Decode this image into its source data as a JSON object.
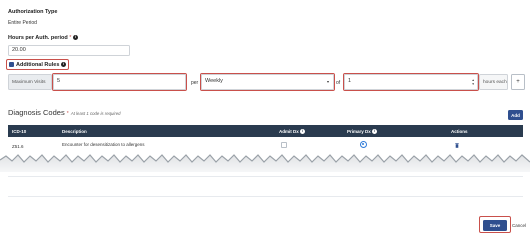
{
  "authorization": {
    "type_label": "Authorization Type",
    "type_value": "Entire Period",
    "hours_label": "Hours per Auth. period",
    "hours_required_mark": "*",
    "hours_value": "20.00"
  },
  "additional_rules": {
    "label": "Additional Rules",
    "checked": true,
    "max_visits_label": "Maximum Visits",
    "max_visits_value": "5",
    "per_label": "per",
    "frequency_selected": "Weekly",
    "of_label": "of",
    "hours_each_value": "1",
    "hours_each_label": "hours each",
    "add_button_label": "+"
  },
  "diagnosis": {
    "title": "Diagnosis Codes",
    "required_mark": "*",
    "hint": "At least 1 code is required",
    "add_button": "Add",
    "columns": [
      "ICD-10",
      "Description",
      "Admit Dx",
      "Primary Dx",
      "Actions"
    ],
    "rows": [
      {
        "icd10": "Z51.6",
        "description": "Encounter for desensitization to allergens",
        "admit_dx": false,
        "primary_dx": true
      }
    ]
  },
  "footer": {
    "save_label": "Save",
    "cancel_label": "Cancel"
  },
  "colors": {
    "accent": "#2f4f8f",
    "table_header": "#2a3b4f",
    "highlight": "#c9504b"
  }
}
